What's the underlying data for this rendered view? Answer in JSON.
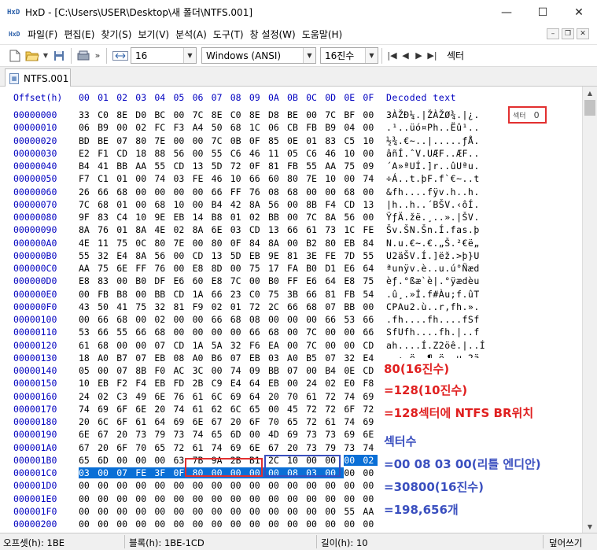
{
  "window": {
    "app_icon": "HxD",
    "title": "HxD - [C:\\Users\\USER\\Desktop\\새 폴더\\NTFS.001]",
    "minimize": "—",
    "maximize": "☐",
    "close": "✕"
  },
  "menu": {
    "icon": "HxD",
    "items": [
      "파일(F)",
      "편집(E)",
      "찾기(S)",
      "보기(V)",
      "분석(A)",
      "도구(T)",
      "창 설정(W)",
      "도움말(H)"
    ],
    "mdi_min": "–",
    "mdi_restore": "❐",
    "mdi_close": "✕"
  },
  "toolbar": {
    "bytes_per_row": "16",
    "charset": "Windows (ANSI)",
    "offset_base": "16진수",
    "view_label": "섹터",
    "more": "»"
  },
  "tab": {
    "label": "NTFS.001"
  },
  "hex": {
    "header_offset": "Offset(h)",
    "header_columns": [
      "00",
      "01",
      "02",
      "03",
      "04",
      "05",
      "06",
      "07",
      "08",
      "09",
      "0A",
      "0B",
      "0C",
      "0D",
      "0E",
      "0F"
    ],
    "header_text": "Decoded text",
    "rows": [
      {
        "offset": "00000000",
        "bytes": [
          "33",
          "C0",
          "8E",
          "D0",
          "BC",
          "00",
          "7C",
          "8E",
          "C0",
          "8E",
          "D8",
          "BE",
          "00",
          "7C",
          "BF",
          "00"
        ],
        "text": "3ÀŽÐ¼.|ŽÀŽØ¾.|¿."
      },
      {
        "offset": "00000010",
        "bytes": [
          "06",
          "B9",
          "00",
          "02",
          "FC",
          "F3",
          "A4",
          "50",
          "68",
          "1C",
          "06",
          "CB",
          "FB",
          "B9",
          "04",
          "00"
        ],
        "text": ".¹..üó¤Ph..Ëû¹.."
      },
      {
        "offset": "00000020",
        "bytes": [
          "BD",
          "BE",
          "07",
          "80",
          "7E",
          "00",
          "00",
          "7C",
          "0B",
          "0F",
          "85",
          "0E",
          "01",
          "83",
          "C5",
          "10"
        ],
        "text": "½¾.€~..|.....ƒÅ."
      },
      {
        "offset": "00000030",
        "bytes": [
          "E2",
          "F1",
          "CD",
          "18",
          "88",
          "56",
          "00",
          "55",
          "C6",
          "46",
          "11",
          "05",
          "C6",
          "46",
          "10",
          "00"
        ],
        "text": "âñÍ.ˆV.UÆF..ÆF.."
      },
      {
        "offset": "00000040",
        "bytes": [
          "B4",
          "41",
          "BB",
          "AA",
          "55",
          "CD",
          "13",
          "5D",
          "72",
          "0F",
          "81",
          "FB",
          "55",
          "AA",
          "75",
          "09"
        ],
        "text": "´A»ªUÍ.]r..ûUªu."
      },
      {
        "offset": "00000050",
        "bytes": [
          "F7",
          "C1",
          "01",
          "00",
          "74",
          "03",
          "FE",
          "46",
          "10",
          "66",
          "60",
          "80",
          "7E",
          "10",
          "00",
          "74"
        ],
        "text": "÷Á..t.þF.f`€~..t"
      },
      {
        "offset": "00000060",
        "bytes": [
          "26",
          "66",
          "68",
          "00",
          "00",
          "00",
          "00",
          "66",
          "FF",
          "76",
          "08",
          "68",
          "00",
          "00",
          "68",
          "00"
        ],
        "text": "&fh....fÿv.h..h."
      },
      {
        "offset": "00000070",
        "bytes": [
          "7C",
          "68",
          "01",
          "00",
          "68",
          "10",
          "00",
          "B4",
          "42",
          "8A",
          "56",
          "00",
          "8B",
          "F4",
          "CD",
          "13"
        ],
        "text": "|h..h..´BŠV.‹ôÍ."
      },
      {
        "offset": "00000080",
        "bytes": [
          "9F",
          "83",
          "C4",
          "10",
          "9E",
          "EB",
          "14",
          "B8",
          "01",
          "02",
          "BB",
          "00",
          "7C",
          "8A",
          "56",
          "00"
        ],
        "text": "ŸƒÄ.žë.¸..».|ŠV."
      },
      {
        "offset": "00000090",
        "bytes": [
          "8A",
          "76",
          "01",
          "8A",
          "4E",
          "02",
          "8A",
          "6E",
          "03",
          "CD",
          "13",
          "66",
          "61",
          "73",
          "1C",
          "FE"
        ],
        "text": "Šv.ŠN.Šn.Í.fas.þ"
      },
      {
        "offset": "000000A0",
        "bytes": [
          "4E",
          "11",
          "75",
          "0C",
          "80",
          "7E",
          "00",
          "80",
          "0F",
          "84",
          "8A",
          "00",
          "B2",
          "80",
          "EB",
          "84"
        ],
        "text": "N.u.€~.€.„Š.²€ë„"
      },
      {
        "offset": "000000B0",
        "bytes": [
          "55",
          "32",
          "E4",
          "8A",
          "56",
          "00",
          "CD",
          "13",
          "5D",
          "EB",
          "9E",
          "81",
          "3E",
          "FE",
          "7D",
          "55"
        ],
        "text": "U2äŠV.Í.]ëž.>þ}U"
      },
      {
        "offset": "000000C0",
        "bytes": [
          "AA",
          "75",
          "6E",
          "FF",
          "76",
          "00",
          "E8",
          "8D",
          "00",
          "75",
          "17",
          "FA",
          "B0",
          "D1",
          "E6",
          "64"
        ],
        "text": "ªunÿv.è..u.ú°Ñæd"
      },
      {
        "offset": "000000D0",
        "bytes": [
          "E8",
          "83",
          "00",
          "B0",
          "DF",
          "E6",
          "60",
          "E8",
          "7C",
          "00",
          "B0",
          "FF",
          "E6",
          "64",
          "E8",
          "75"
        ],
        "text": "èƒ.°ßæ`è|.°ÿædèu"
      },
      {
        "offset": "000000E0",
        "bytes": [
          "00",
          "FB",
          "B8",
          "00",
          "BB",
          "CD",
          "1A",
          "66",
          "23",
          "C0",
          "75",
          "3B",
          "66",
          "81",
          "FB",
          "54"
        ],
        "text": ".û¸.»Í.f#Àu;f.ûT"
      },
      {
        "offset": "000000F0",
        "bytes": [
          "43",
          "50",
          "41",
          "75",
          "32",
          "81",
          "F9",
          "02",
          "01",
          "72",
          "2C",
          "66",
          "68",
          "07",
          "BB",
          "00"
        ],
        "text": "CPAu2.ù..r,fh.»."
      },
      {
        "offset": "00000100",
        "bytes": [
          "00",
          "66",
          "68",
          "00",
          "02",
          "00",
          "00",
          "66",
          "68",
          "08",
          "00",
          "00",
          "00",
          "66",
          "53",
          "66"
        ],
        "text": ".fh....fh....fSf"
      },
      {
        "offset": "00000110",
        "bytes": [
          "53",
          "66",
          "55",
          "66",
          "68",
          "00",
          "00",
          "00",
          "00",
          "66",
          "68",
          "00",
          "7C",
          "00",
          "00",
          "66"
        ],
        "text": "SfUfh....fh.|..f"
      },
      {
        "offset": "00000120",
        "bytes": [
          "61",
          "68",
          "00",
          "00",
          "07",
          "CD",
          "1A",
          "5A",
          "32",
          "F6",
          "EA",
          "00",
          "7C",
          "00",
          "00",
          "CD"
        ],
        "text": "ah....Í.Z2öê.|..Í"
      },
      {
        "offset": "00000130",
        "bytes": [
          "18",
          "A0",
          "B7",
          "07",
          "EB",
          "08",
          "A0",
          "B6",
          "07",
          "EB",
          "03",
          "A0",
          "B5",
          "07",
          "32",
          "E4"
        ],
        "text": ". ·.ë. ¶.ë. µ.2ä"
      },
      {
        "offset": "00000140",
        "bytes": [
          "05",
          "00",
          "07",
          "8B",
          "F0",
          "AC",
          "3C",
          "00",
          "74",
          "09",
          "BB",
          "07",
          "00",
          "B4",
          "0E",
          "CD"
        ],
        "text": "...‹ð¬<.t.»..´.Í"
      },
      {
        "offset": "00000150",
        "bytes": [
          "10",
          "EB",
          "F2",
          "F4",
          "EB",
          "FD",
          "2B",
          "C9",
          "E4",
          "64",
          "EB",
          "00",
          "24",
          "02",
          "E0",
          "F8"
        ],
        "text": ".ëòôëý+Éädë.$.àø"
      },
      {
        "offset": "00000160",
        "bytes": [
          "24",
          "02",
          "C3",
          "49",
          "6E",
          "76",
          "61",
          "6C",
          "69",
          "64",
          "20",
          "70",
          "61",
          "72",
          "74",
          "69"
        ],
        "text": "$.ÃInvalid parti"
      },
      {
        "offset": "00000170",
        "bytes": [
          "74",
          "69",
          "6F",
          "6E",
          "20",
          "74",
          "61",
          "62",
          "6C",
          "65",
          "00",
          "45",
          "72",
          "72",
          "6F",
          "72"
        ],
        "text": "tion table.Error"
      },
      {
        "offset": "00000180",
        "bytes": [
          "20",
          "6C",
          "6F",
          "61",
          "64",
          "69",
          "6E",
          "67",
          "20",
          "6F",
          "70",
          "65",
          "72",
          "61",
          "74",
          "69"
        ],
        "text": " loading operati"
      },
      {
        "offset": "00000190",
        "bytes": [
          "6E",
          "67",
          "20",
          "73",
          "79",
          "73",
          "74",
          "65",
          "6D",
          "00",
          "4D",
          "69",
          "73",
          "73",
          "69",
          "6E"
        ],
        "text": "ng system.Missin"
      },
      {
        "offset": "000001A0",
        "bytes": [
          "67",
          "20",
          "6F",
          "70",
          "65",
          "72",
          "61",
          "74",
          "69",
          "6E",
          "67",
          "20",
          "73",
          "79",
          "73",
          "74"
        ],
        "text": "g operating syst"
      },
      {
        "offset": "000001B0",
        "bytes": [
          "65",
          "6D",
          "00",
          "00",
          "00",
          "63",
          "7B",
          "9A",
          "2B",
          "B1",
          "2C",
          "10",
          "00",
          "00",
          "00",
          "02"
        ],
        "text": "em...c{š+±,....."
      },
      {
        "offset": "000001C0",
        "bytes": [
          "03",
          "00",
          "07",
          "FE",
          "3F",
          "0F",
          "80",
          "00",
          "00",
          "00",
          "00",
          "08",
          "03",
          "00",
          "00",
          "00"
        ],
        "text": "...þ?.€........."
      },
      {
        "offset": "000001D0",
        "bytes": [
          "00",
          "00",
          "00",
          "00",
          "00",
          "00",
          "00",
          "00",
          "00",
          "00",
          "00",
          "00",
          "00",
          "00",
          "00",
          "00"
        ],
        "text": "................"
      },
      {
        "offset": "000001E0",
        "bytes": [
          "00",
          "00",
          "00",
          "00",
          "00",
          "00",
          "00",
          "00",
          "00",
          "00",
          "00",
          "00",
          "00",
          "00",
          "00",
          "00"
        ],
        "text": "................"
      },
      {
        "offset": "000001F0",
        "bytes": [
          "00",
          "00",
          "00",
          "00",
          "00",
          "00",
          "00",
          "00",
          "00",
          "00",
          "00",
          "00",
          "00",
          "00",
          "55",
          "AA"
        ],
        "text": "..............Uª"
      },
      {
        "offset": "00000200",
        "bytes": [
          "00",
          "00",
          "00",
          "00",
          "00",
          "00",
          "00",
          "00",
          "00",
          "00",
          "00",
          "00",
          "00",
          "00",
          "00",
          "00"
        ],
        "text": "................"
      }
    ],
    "selection": {
      "row_start": 27,
      "col_start": 14,
      "row_end": 28,
      "col_end": 13
    },
    "highlight_start": {
      "row": 28,
      "col_start": 6,
      "col_end": 9
    },
    "highlight_size": {
      "row": 28,
      "col_start": 10,
      "col_end": 13
    }
  },
  "sector_indicator": {
    "label": "섹터",
    "value": "0"
  },
  "notes": {
    "line1": "80(16진수)",
    "line2": "=128(10진수)",
    "line3": "=128섹터에 NTFS BR위치",
    "line4": "섹터수",
    "line5": "=00 08 03 00(리틀 엔디안)",
    "line6": "=30800(16진수)",
    "line7": "=198,656개"
  },
  "status": {
    "offset": "오프셋(h): 1BE",
    "block": "블록(h): 1BE-1CD",
    "length": "길이(h): 10",
    "mode": "덮어쓰기"
  },
  "colors": {
    "offset_blue": "#0000c0",
    "selection": "#0a6fd6",
    "annotation_red": "#e02020",
    "annotation_blue": "#3a4fbf"
  }
}
